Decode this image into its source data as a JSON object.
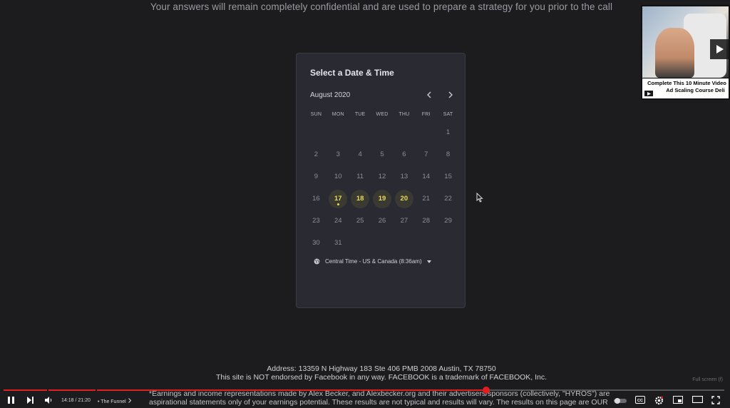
{
  "header": {
    "subtitle": "Your answers will remain completely confidential and are used to prepare a strategy for you prior to the call"
  },
  "calendar": {
    "title": "Select a Date & Time",
    "month_label": "August 2020",
    "weekdays": [
      "SUN",
      "MON",
      "TUE",
      "WED",
      "THU",
      "FRI",
      "SAT"
    ],
    "first_weekday_index": 6,
    "days_in_month": 31,
    "available_days": [
      17,
      18,
      19,
      20
    ],
    "today": 17,
    "timezone": "Central Time - US & Canada (8:36am)"
  },
  "thumbnail": {
    "caption_line1": "Complete This 10 Minute Video",
    "caption_line2": "Ad Scaling Course Deli"
  },
  "footer": {
    "address": "Address: 13359 N Highway 183 Ste 406 PMB 2008 Austin, TX 78750",
    "endorse": "This site is NOT endorsed by Facebook in any way. FACEBOOK is a trademark of FACEBOOK, Inc.",
    "disclaimer_line1": "*Earnings and income representations made by Alex Becker, and Alexbecker.org and their advertisers/sponsors (collectively, \"HYROS\") are",
    "disclaimer_line2": "aspirational statements only of your earnings potential. These results are not typical and results will vary. The results on this page are OUR"
  },
  "player": {
    "current_time": "14:18",
    "duration": "21:20",
    "time_display": "14:18 / 21:20",
    "chapter": "• The Funnel",
    "progress_fraction": 0.67,
    "fullscreen_hint": "Full screen (f)"
  },
  "colors": {
    "background": "#1c1c1f",
    "card": "#2a2a33",
    "accent_available": "#e8dc5a",
    "progress": "#e02020"
  }
}
